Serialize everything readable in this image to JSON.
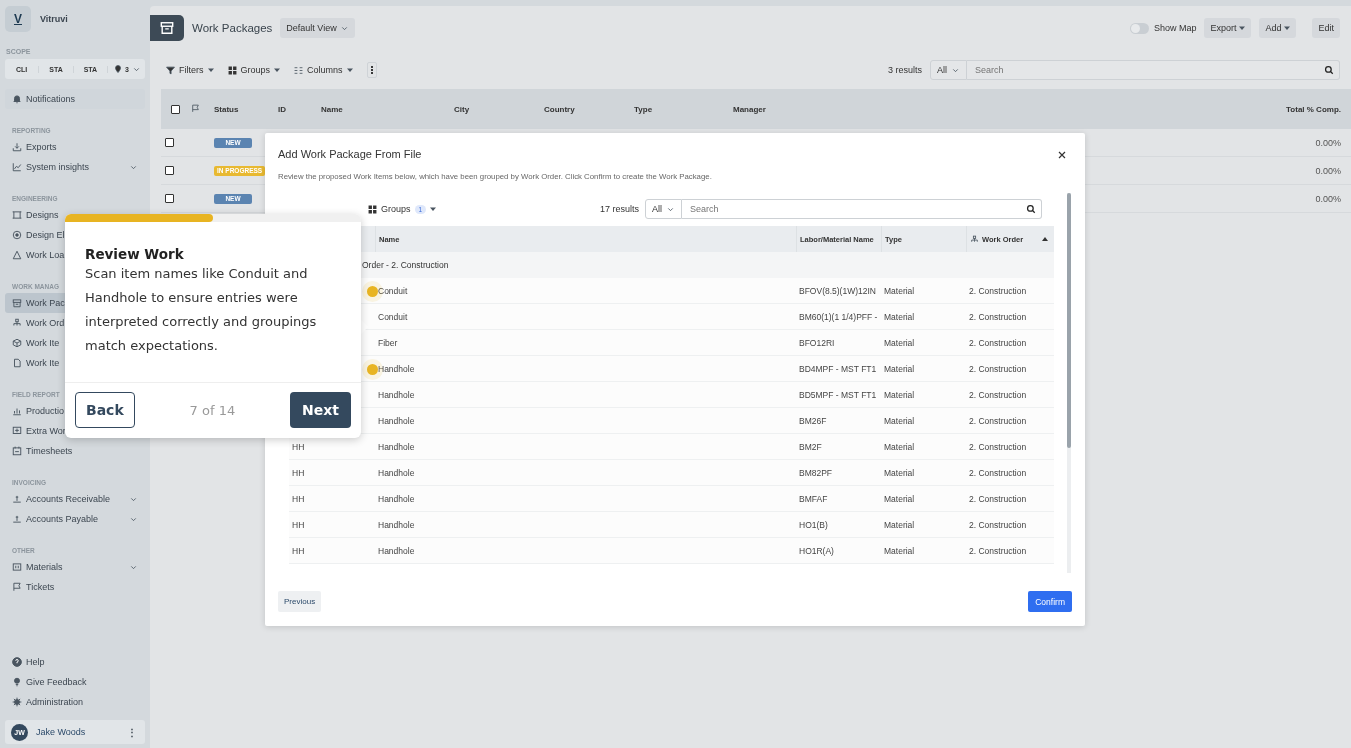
{
  "sidebar": {
    "brand": {
      "logo": "V",
      "name": "Vitruvi"
    },
    "scope": {
      "label": "SCOPE",
      "chips": [
        "CLI",
        "STA",
        "STA"
      ],
      "location_count": "3"
    },
    "notifications": "Notifications",
    "sections": [
      {
        "heading": "REPORTING",
        "items": [
          {
            "label": "Exports",
            "expandable": false,
            "selected": false
          },
          {
            "label": "System insights",
            "expandable": true,
            "selected": false
          }
        ]
      },
      {
        "heading": "ENGINEERING",
        "items": [
          {
            "label": "Designs",
            "selected": false
          },
          {
            "label": "Design El",
            "selected": false
          },
          {
            "label": "Work Loa",
            "selected": false
          }
        ]
      },
      {
        "heading": "WORK MANAG",
        "items": [
          {
            "label": "Work Pac",
            "selected": true
          },
          {
            "label": "Work Ord",
            "selected": false
          },
          {
            "label": "Work Ite",
            "selected": false
          },
          {
            "label": "Work Ite",
            "selected": false
          }
        ]
      },
      {
        "heading": "FIELD REPORT",
        "items": [
          {
            "label": "Productio",
            "selected": false
          },
          {
            "label": "Extra Wor",
            "selected": false
          },
          {
            "label": "Timesheets",
            "expandable": false,
            "selected": false
          }
        ]
      },
      {
        "heading": "INVOICING",
        "items": [
          {
            "label": "Accounts Receivable",
            "expandable": true,
            "selected": false
          },
          {
            "label": "Accounts Payable",
            "expandable": true,
            "selected": false
          }
        ]
      },
      {
        "heading": "OTHER",
        "items": [
          {
            "label": "Materials",
            "expandable": true,
            "selected": false
          },
          {
            "label": "Tickets",
            "expandable": false,
            "selected": false
          }
        ]
      }
    ],
    "footer_items": [
      "Help",
      "Give Feedback",
      "Administration"
    ],
    "user": {
      "initials": "JW",
      "name": "Jake Woods",
      "menu": "⋮"
    }
  },
  "header": {
    "title": "Work Packages",
    "view": "Default View",
    "show_map": {
      "label": "Show Map",
      "on": false
    },
    "buttons": [
      "Export",
      "Add"
    ],
    "edit": "Edit"
  },
  "toolbar": {
    "filters": "Filters",
    "groups": "Groups",
    "columns": "Columns",
    "results": "3 results",
    "scope": "All",
    "search": {
      "placeholder": "Search"
    }
  },
  "table": {
    "select_all_checked": false,
    "columns": [
      "Status",
      "ID",
      "Name",
      "City",
      "Country",
      "Type",
      "Manager",
      "Total % Comp."
    ],
    "rows": [
      {
        "checked": false,
        "status": "NEW",
        "color": "#5b84b1",
        "total": "0.00%"
      },
      {
        "checked": false,
        "status": "IN PROGRESS",
        "color": "#e8b931",
        "total": "0.00%"
      },
      {
        "checked": false,
        "status": "NEW",
        "color": "#5b84b1",
        "total": "0.00%"
      }
    ]
  },
  "modal": {
    "title": "Add Work Package From File",
    "description": "Review the proposed Work Items below, which have been grouped by Work Order. Click Confirm to create the Work Package.",
    "groups": {
      "label": "Groups",
      "count": "1"
    },
    "results": "17 results",
    "scope": "All",
    "search": {
      "placeholder": "Search"
    },
    "columns": [
      "Name",
      "Labor/Material Name",
      "Type",
      "Work Order"
    ],
    "group_label": "Order - 2. Construction",
    "rows": [
      {
        "name": "Conduit",
        "labor_material": "BFOV(8.5)(1W)12IN",
        "type": "Material",
        "work_order": "2. Construction",
        "highlighted": true
      },
      {
        "name": "Conduit",
        "labor_material": "BM60(1)(1 1/4)PFF -",
        "type": "Material",
        "work_order": "2. Construction",
        "highlighted": false
      },
      {
        "name": "Fiber",
        "labor_material": "BFO12RI",
        "type": "Material",
        "work_order": "2. Construction",
        "highlighted": false
      },
      {
        "name": "Handhole",
        "labor_material": "BD4MPF - MST FT1",
        "type": "Material",
        "work_order": "2. Construction",
        "highlighted": true
      },
      {
        "name": "Handhole",
        "labor_material": "BD5MPF - MST FT1",
        "type": "Material",
        "work_order": "2. Construction",
        "highlighted": false
      },
      {
        "name": "Handhole",
        "labor_material": "BM26F",
        "type": "Material",
        "work_order": "2. Construction",
        "highlighted": false
      },
      {
        "column_1": "HH",
        "name": "Handhole",
        "labor_material": "BM2F",
        "type": "Material",
        "work_order": "2. Construction",
        "highlighted": false
      },
      {
        "column_1": "HH",
        "name": "Handhole",
        "labor_material": "BM82PF",
        "type": "Material",
        "work_order": "2. Construction",
        "highlighted": false
      },
      {
        "column_1": "HH",
        "name": "Handhole",
        "labor_material": "BMFAF",
        "type": "Material",
        "work_order": "2. Construction",
        "highlighted": false
      },
      {
        "column_1": "HH",
        "name": "Handhole",
        "labor_material": "HO1(B)",
        "type": "Material",
        "work_order": "2. Construction",
        "highlighted": false
      },
      {
        "column_1": "HH",
        "name": "Handhole",
        "labor_material": "HO1R(A)",
        "type": "Material",
        "work_order": "2. Construction",
        "highlighted": false
      }
    ],
    "previous": "Previous",
    "confirm": "Confirm"
  },
  "tour": {
    "level": 0.5,
    "title": "Review Work",
    "body": "Scan item names like Conduit and Handhole to ensure entries were interpreted correctly and groupings match expectations.",
    "back": "Back",
    "step": "7 of 14",
    "next": "Next"
  }
}
